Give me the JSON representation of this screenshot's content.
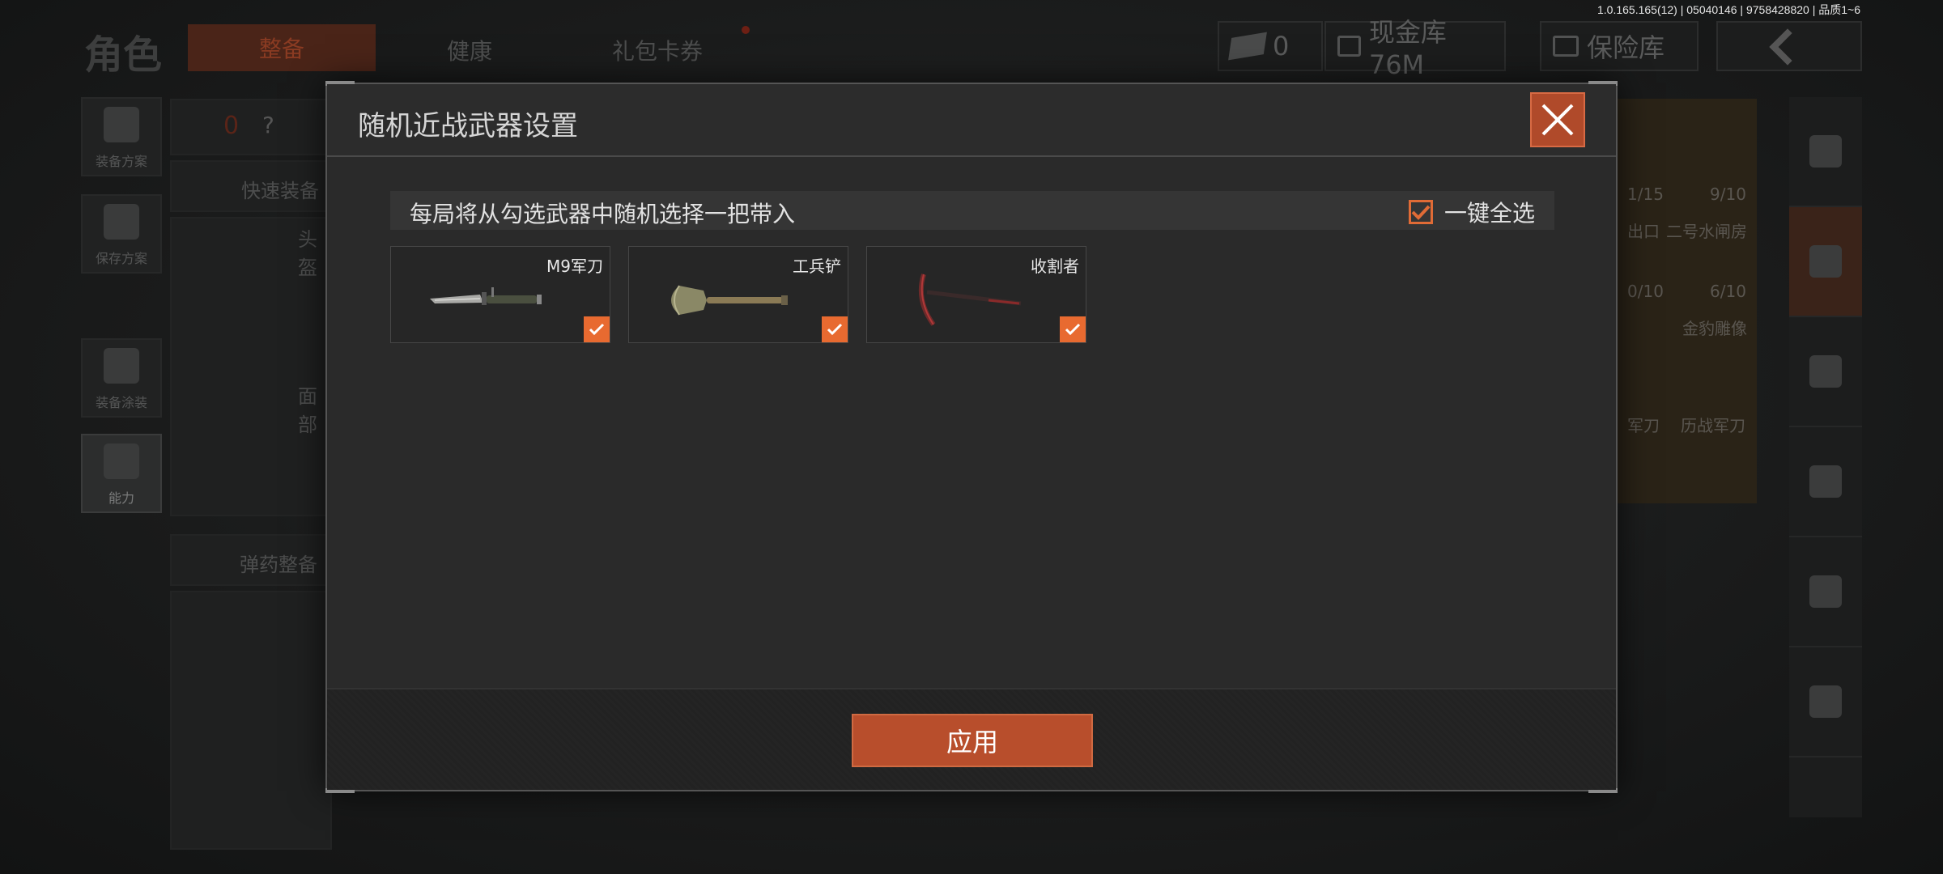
{
  "version_info": "1.0.165.165(12) | 05040146 | 9758428820 | 品质1~6",
  "background": {
    "page_title": "角色",
    "tabs": [
      {
        "label": "整备",
        "active": true
      },
      {
        "label": "健康",
        "active": false
      },
      {
        "label": "礼包卡券",
        "active": false
      }
    ],
    "currency_count": "0",
    "cash_vault": "现金库 76M",
    "safe_box": "保险库",
    "side_buttons": [
      {
        "label": "装备方案"
      },
      {
        "label": "保存方案"
      },
      {
        "label": "装备涂装"
      },
      {
        "label": "能力",
        "active": true
      }
    ],
    "risk_count": "0",
    "risk_help": "?",
    "quick_equip": "快速装备",
    "head_slot": "头盔",
    "face_slot": "面部",
    "ammo_equip": "弹药整备",
    "right_items": [
      {
        "label": "1/15"
      },
      {
        "label": "9/10"
      },
      {
        "label": "出口"
      },
      {
        "label": "二号水闸房"
      },
      {
        "label": "0/10"
      },
      {
        "label": "6/10"
      },
      {
        "label": "金豹雕像"
      },
      {
        "label": "军刀"
      },
      {
        "label": "历战军刀"
      }
    ]
  },
  "dialog": {
    "title": "随机近战武器设置",
    "info_text": "每局将从勾选武器中随机选择一把带入",
    "select_all_label": "一键全选",
    "select_all_checked": true,
    "weapons": [
      {
        "name": "M9军刀",
        "icon": "knife-icon",
        "checked": true
      },
      {
        "name": "工兵铲",
        "icon": "shovel-icon",
        "checked": true
      },
      {
        "name": "收割者",
        "icon": "pickaxe-icon",
        "checked": true
      }
    ],
    "apply_label": "应用"
  },
  "colors": {
    "accent": "#e86a30",
    "button": "#b84e2c",
    "dialog_bg": "#2a2a2a"
  }
}
